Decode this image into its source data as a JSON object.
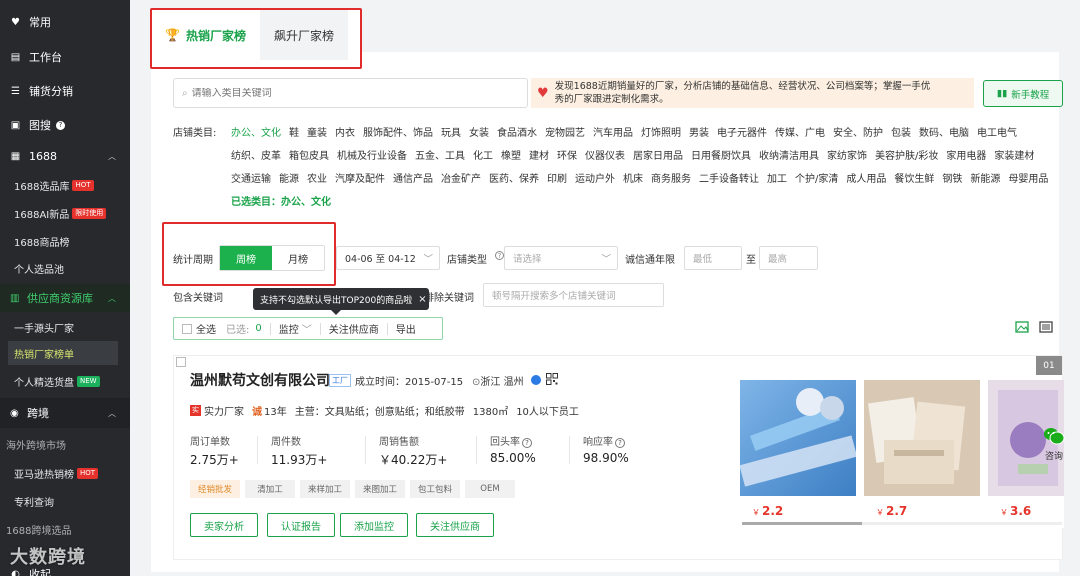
{
  "sidebar": {
    "items": [
      {
        "label": "常用",
        "icon": "heart-icon"
      },
      {
        "label": "工作台",
        "icon": "desk-icon"
      },
      {
        "label": "铺货分销",
        "icon": "list-icon"
      },
      {
        "label": "图搜",
        "icon": "image-search-icon"
      },
      {
        "label": "1688",
        "icon": "store-icon"
      }
    ],
    "sub_1688": [
      {
        "label": "1688选品库",
        "badge": "HOT"
      },
      {
        "label": "1688AI新品",
        "badge": "限时使用"
      },
      {
        "label": "1688商品榜",
        "badge": ""
      },
      {
        "label": "个人选品池",
        "badge": ""
      }
    ],
    "supply_section": "供应商资源库",
    "sub_supply": [
      {
        "label": "一手源头厂家",
        "badge": ""
      },
      {
        "label": "热销厂家榜单",
        "badge": ""
      },
      {
        "label": "个人精选货盘",
        "badge": "NEW"
      }
    ],
    "crossborder_section": "跨境",
    "cross_market": "海外跨境市场",
    "sub_cross": [
      {
        "label": "亚马逊热销榜",
        "badge": "HOT"
      },
      {
        "label": "专利查询",
        "badge": ""
      }
    ],
    "cross_select": "1688跨境选品",
    "collapse_label": "收起"
  },
  "watermark": "大数跨境",
  "tabs": [
    {
      "label": "热销厂家榜"
    },
    {
      "label": "飙升厂家榜"
    }
  ],
  "search": {
    "placeholder": "请输入类目关键词"
  },
  "notice": {
    "line1": "发现1688近期销量好的厂家，分析店铺的基础信息、经营状况、公司档案等；掌握一手优",
    "line2": "秀的厂家跟进定制化需求。"
  },
  "tutorial_label": "新手教程",
  "category": {
    "label": "店铺类目:",
    "items": [
      "办公、文化",
      "鞋",
      "童装",
      "内衣",
      "服饰配件、饰品",
      "玩具",
      "女装",
      "食品酒水",
      "宠物园艺",
      "汽车用品",
      "灯饰照明",
      "男装",
      "电子元器件",
      "传媒、广电",
      "安全、防护",
      "包装",
      "数码、电脑",
      "电工电气",
      "纺织、皮革",
      "箱包皮具",
      "机械及行业设备",
      "五金、工具",
      "化工",
      "橡塑",
      "建材",
      "环保",
      "仪器仪表",
      "居家日用品",
      "日用餐厨饮具",
      "收纳清洁用具",
      "家纺家饰",
      "美容护肤/彩妆",
      "家用电器",
      "家装建材",
      "交通运输",
      "能源",
      "农业",
      "汽摩及配件",
      "通信产品",
      "冶金矿产",
      "医药、保养",
      "印刷",
      "运动户外",
      "机床",
      "商务服务",
      "二手设备转让",
      "加工",
      "个护/家清",
      "成人用品",
      "餐饮生鲜",
      "钢铁",
      "新能源",
      "母婴用品"
    ],
    "selected_summary": "已选类目：办公、文化"
  },
  "filters": {
    "period_label": "统计周期",
    "week": "周榜",
    "month": "月榜",
    "date_range": "04-06 至 04-12",
    "store_type_label": "店铺类型",
    "store_type_placeholder": "请选择",
    "years_label": "诚信通年限",
    "min_placeholder": "最低",
    "to": "至",
    "max_placeholder": "最高",
    "include_kw_label": "包含关键词",
    "exclude_kw_label": "排除关键词",
    "exclude_placeholder": "顿号隔开搜索多个店铺关键词"
  },
  "tooltip": "支持不勾选默认导出TOP200的商品啦",
  "tooltip_close": "×",
  "actions": {
    "select_all": "全选",
    "selected": "已选:",
    "selected_count": "0",
    "monitor": "监控",
    "follow": "关注供应商",
    "export": "导出"
  },
  "card": {
    "rank": "01",
    "company": "温州默苟文创有限公司",
    "factory_tag": "工厂",
    "established": "成立时间：2015-07-15",
    "location": "浙江 温州",
    "strength": "实力厂家",
    "years": "13年",
    "main_business": "主营：文具贴纸；创意贴纸；和纸胶带",
    "area": "1380㎡",
    "staff": "10人以下员工",
    "stats": [
      {
        "label": "周订单数",
        "value": "2.75万+",
        "help": false
      },
      {
        "label": "周件数",
        "value": "11.93万+",
        "help": false
      },
      {
        "label": "周销售额",
        "value": "￥40.22万+",
        "help": false
      },
      {
        "label": "回头率",
        "value": "85.00%",
        "help": true
      },
      {
        "label": "响应率",
        "value": "98.90%",
        "help": true
      }
    ],
    "tags": [
      "经销批发",
      "清加工",
      "来样加工",
      "来图加工",
      "包工包料",
      "OEM"
    ],
    "buttons": [
      "卖家分析",
      "认证报告",
      "添加监控",
      "关注供应商"
    ],
    "products": [
      {
        "price": "2.2"
      },
      {
        "price": "2.7"
      },
      {
        "price": "3.6"
      }
    ],
    "currency": "￥"
  },
  "consult_label": "咨询",
  "colors": {
    "accent": "#1aa34a",
    "highlight_box": "#e12b2b",
    "price": "#e5352b"
  }
}
